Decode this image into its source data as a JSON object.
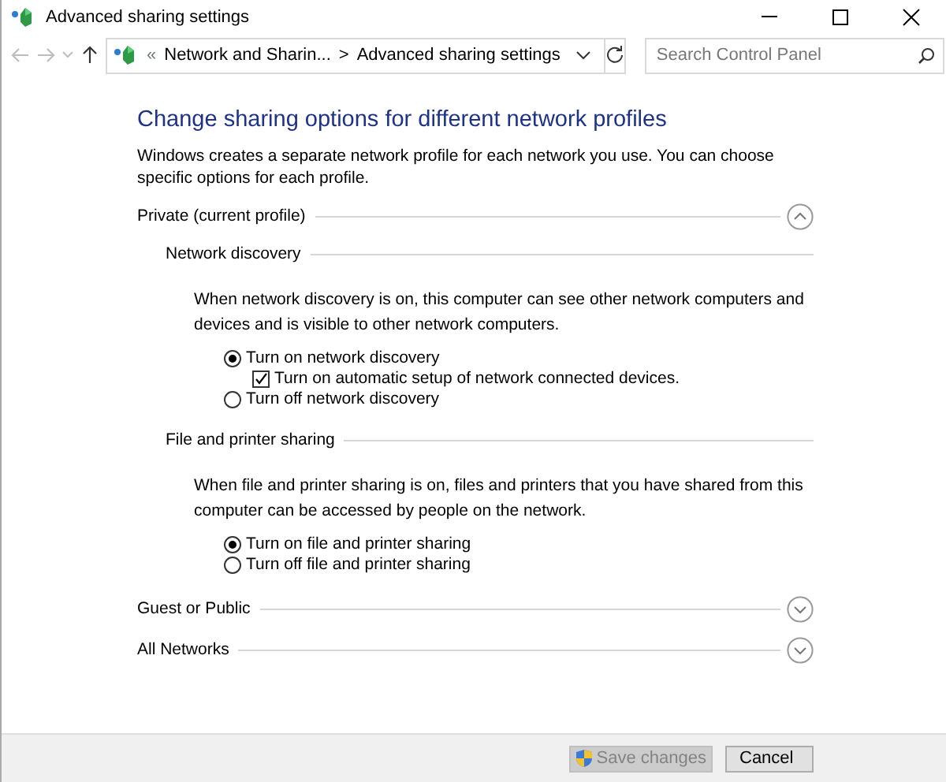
{
  "window": {
    "title": "Advanced sharing settings"
  },
  "nav": {
    "back_disabled": true,
    "forward_disabled": true
  },
  "address": {
    "overflow": "«",
    "crumbs": [
      "Network and Sharin...",
      "Advanced sharing settings"
    ],
    "separator": ">"
  },
  "search": {
    "placeholder": "Search Control Panel"
  },
  "heading": "Change sharing options for different network profiles",
  "intro": "Windows creates a separate network profile for each network you use. You can choose specific options for each profile.",
  "profiles": [
    {
      "title": "Private (current profile)",
      "expanded": true,
      "sections": [
        {
          "title": "Network discovery",
          "description": "When network discovery is on, this computer can see other network computers and devices and is visible to other network computers.",
          "options": [
            {
              "kind": "radio",
              "label": "Turn on network discovery",
              "selected": true,
              "children": [
                {
                  "kind": "checkbox",
                  "label": "Turn on automatic setup of network connected devices.",
                  "checked": true
                }
              ]
            },
            {
              "kind": "radio",
              "label": "Turn off network discovery",
              "selected": false
            }
          ]
        },
        {
          "title": "File and printer sharing",
          "description": "When file and printer sharing is on, files and printers that you have shared from this computer can be accessed by people on the network.",
          "options": [
            {
              "kind": "radio",
              "label": "Turn on file and printer sharing",
              "selected": true
            },
            {
              "kind": "radio",
              "label": "Turn off file and printer sharing",
              "selected": false
            }
          ]
        }
      ]
    },
    {
      "title": "Guest or Public",
      "expanded": false
    },
    {
      "title": "All Networks",
      "expanded": false
    }
  ],
  "buttons": [
    {
      "label": "Save changes",
      "disabled": true,
      "shield": true
    },
    {
      "label": "Cancel",
      "disabled": false,
      "shield": false
    }
  ]
}
